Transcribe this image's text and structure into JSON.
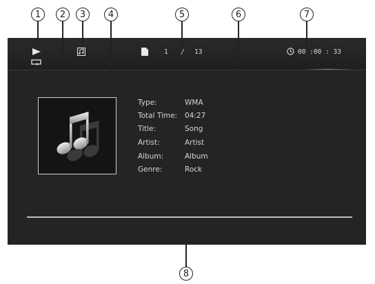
{
  "callouts": [
    "1",
    "2",
    "3",
    "4",
    "5",
    "6",
    "7",
    "8"
  ],
  "status": {
    "play_icon": "play-icon",
    "repeat_icon": "repeat-icon",
    "music_icon": "music-note-icon",
    "file_icon": "file-icon",
    "clock_icon": "clock-icon",
    "current_file": "1",
    "separator": "/",
    "total_files": "13",
    "elapsed_time": "00 :00 : 33"
  },
  "info": {
    "rows": [
      {
        "label": "Type:",
        "value": "WMA"
      },
      {
        "label": "Total Time:",
        "value": "04:27"
      },
      {
        "label": "Title:",
        "value": "Song"
      },
      {
        "label": "Artist:",
        "value": "Artist"
      },
      {
        "label": "Album:",
        "value": "Album"
      },
      {
        "label": "Genre:",
        "value": "Rock"
      }
    ]
  },
  "album_art_icon": "music-notes-icon",
  "colors": {
    "screen": "#242424",
    "text": "#d6d6d6"
  }
}
